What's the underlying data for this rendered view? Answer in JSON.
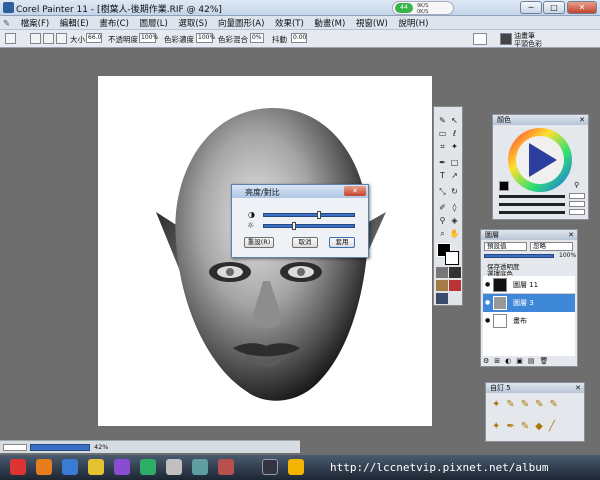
{
  "window": {
    "title": "Corel Painter 11 - [樹葉人-後期作業.RIF @ 42%]",
    "net_badge": "9K/S",
    "net_badge_sub": "0K/S",
    "net_number": "44",
    "buttons": {
      "minimize": "─",
      "maximize": "□",
      "close": "✕"
    }
  },
  "menu": [
    "檔案(F)",
    "編輯(E)",
    "畫布(C)",
    "圖層(L)",
    "選取(S)",
    "向量圖形(A)",
    "效果(T)",
    "動畫(M)",
    "視窗(W)",
    "說明(H)"
  ],
  "property_bar": {
    "size_label": "大小",
    "size_value": "66.0",
    "opacity_label": "不透明度",
    "opacity_value": "100%",
    "saturation_label": "色彩濃度",
    "saturation_value": "100%",
    "blend_label": "色彩混合",
    "blend_value": "0%",
    "smooth_label": "抖動",
    "smooth_value": "0.00",
    "brush_cat_1": "油畫筆",
    "brush_cat_2": "平頭色彩"
  },
  "dialog": {
    "title": "亮度/對比",
    "contrast_icon": "contrast-icon",
    "brightness_icon": "brightness-icon",
    "contrast_level": 0.6,
    "brightness_level": 0.33,
    "reset_label": "重設(R)",
    "cancel_label": "取消",
    "apply_label": "套用"
  },
  "colors_panel": {
    "title": "顏色"
  },
  "layers_panel": {
    "title": "圖層",
    "composite_method": "預設值",
    "composite_depth": "忽略",
    "opacity_value": "100%",
    "preserve_transparency": "保存透明度",
    "pick_up_underlying": "選擇底色",
    "layers": [
      {
        "name": "圖層 11",
        "selected": false
      },
      {
        "name": "圖層 3",
        "selected": true
      },
      {
        "name": "畫布",
        "selected": false
      }
    ]
  },
  "custom_panel": {
    "title": "自訂 5"
  },
  "status": {
    "zoom": "42%"
  },
  "watermark": "http://lccnetvip.pixnet.net/album"
}
